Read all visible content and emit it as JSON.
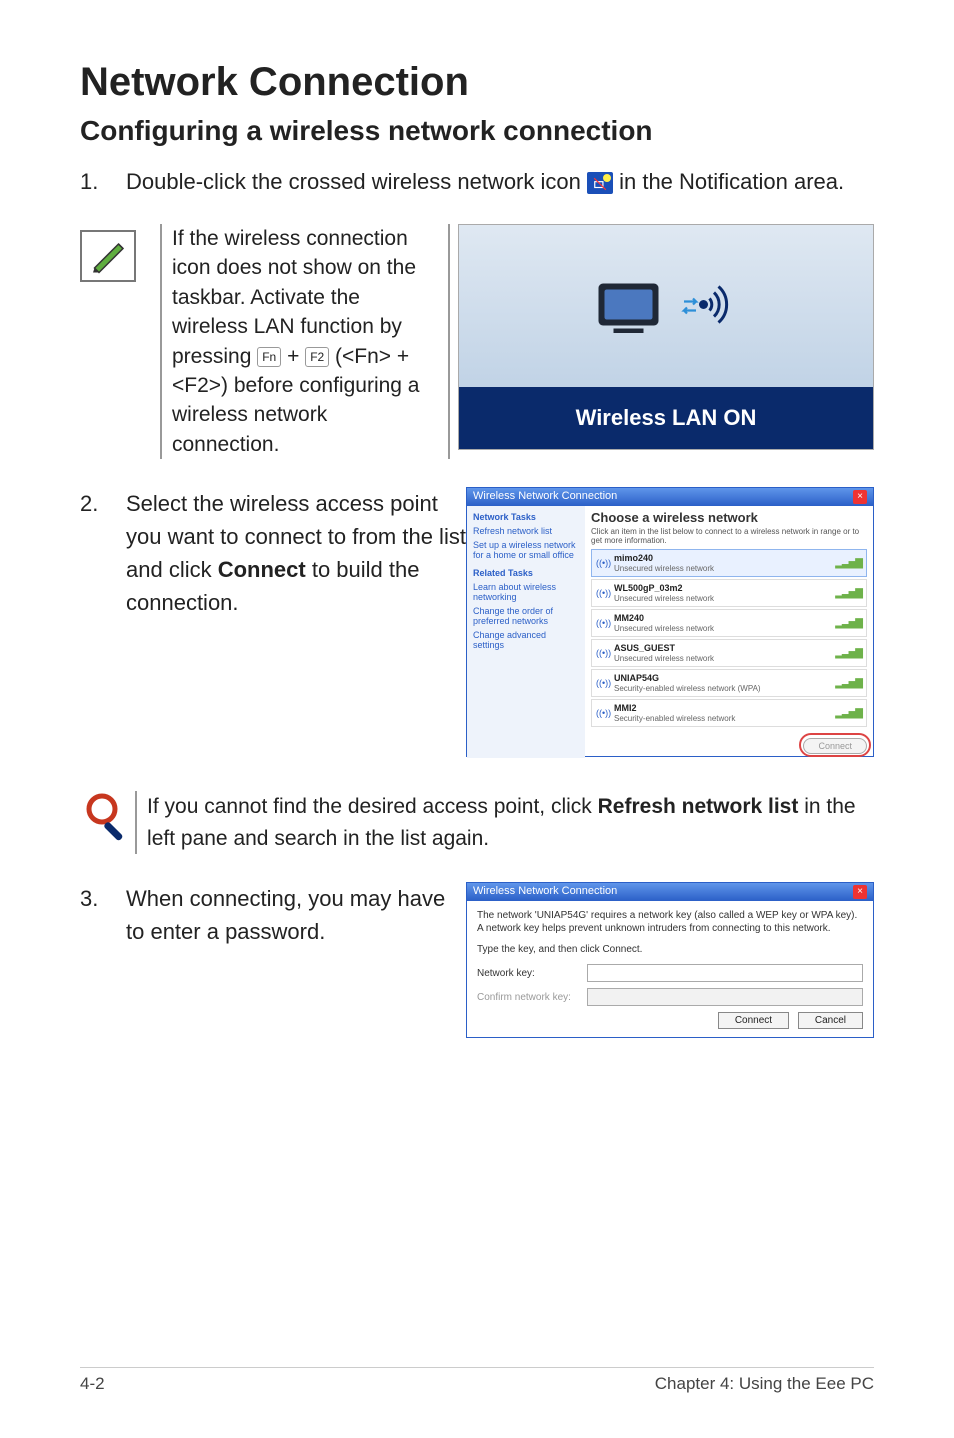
{
  "heading": "Network Connection",
  "subheading": "Configuring a wireless network connection",
  "step1": {
    "num": "1.",
    "pre": "Double-click the crossed wireless network icon ",
    "post": " in the Notification area."
  },
  "note": {
    "line_a": "If the wireless connection icon does not show on the taskbar. Activate the wireless LAN function by pressing ",
    "fn_key": "Fn",
    "plus": " + ",
    "f2_key": "F2",
    "line_b": " (<Fn> + <F2>) before configuring a wireless network connection."
  },
  "wlan_bar": "Wireless LAN ON",
  "step2": {
    "num": "2.",
    "text_a": "Select the wireless access point you want to connect to from the list and click ",
    "bold": "Connect",
    "text_b": " to build the connection.",
    "win_title": "Wireless Network Connection",
    "side": {
      "h1": "Network Tasks",
      "i1": "Refresh network list",
      "i2": "Set up a wireless network for a home or small office",
      "h2": "Related Tasks",
      "i3": "Learn about wireless networking",
      "i4": "Change the order of preferred networks",
      "i5": "Change advanced settings"
    },
    "main_hdr": "Choose a wireless network",
    "main_sub": "Click an item in the list below to connect to a wireless network in range or to get more information.",
    "nets": [
      {
        "name": "mimo240",
        "status": "Unsecured wireless network",
        "sel": true
      },
      {
        "name": "WL500gP_03m2",
        "status": "Unsecured wireless network"
      },
      {
        "name": "MM240",
        "status": "Unsecured wireless network"
      },
      {
        "name": "ASUS_GUEST",
        "status": "Unsecured wireless network"
      },
      {
        "name": "UNIAP54G",
        "status": "Security-enabled wireless network (WPA)"
      },
      {
        "name": "MMI2",
        "status": "Security-enabled wireless network"
      }
    ],
    "connect": "Connect"
  },
  "tip": {
    "a": "If you cannot find the desired access point, click ",
    "b": "Refresh network list",
    "c": " in the left pane and search in the list again."
  },
  "step3": {
    "num": "3.",
    "text": "When connecting, you may have to enter a password.",
    "win_title": "Wireless Network Connection",
    "msg": "The network 'UNIAP54G' requires a network key (also called a WEP key or WPA key). A network key helps prevent unknown intruders from connecting to this network.",
    "type_msg": "Type the key, and then click Connect.",
    "lbl1": "Network key:",
    "lbl2": "Confirm network key:",
    "btn1": "Connect",
    "btn2": "Cancel"
  },
  "footer_left": "4-2",
  "footer_right": "Chapter 4: Using the Eee PC"
}
